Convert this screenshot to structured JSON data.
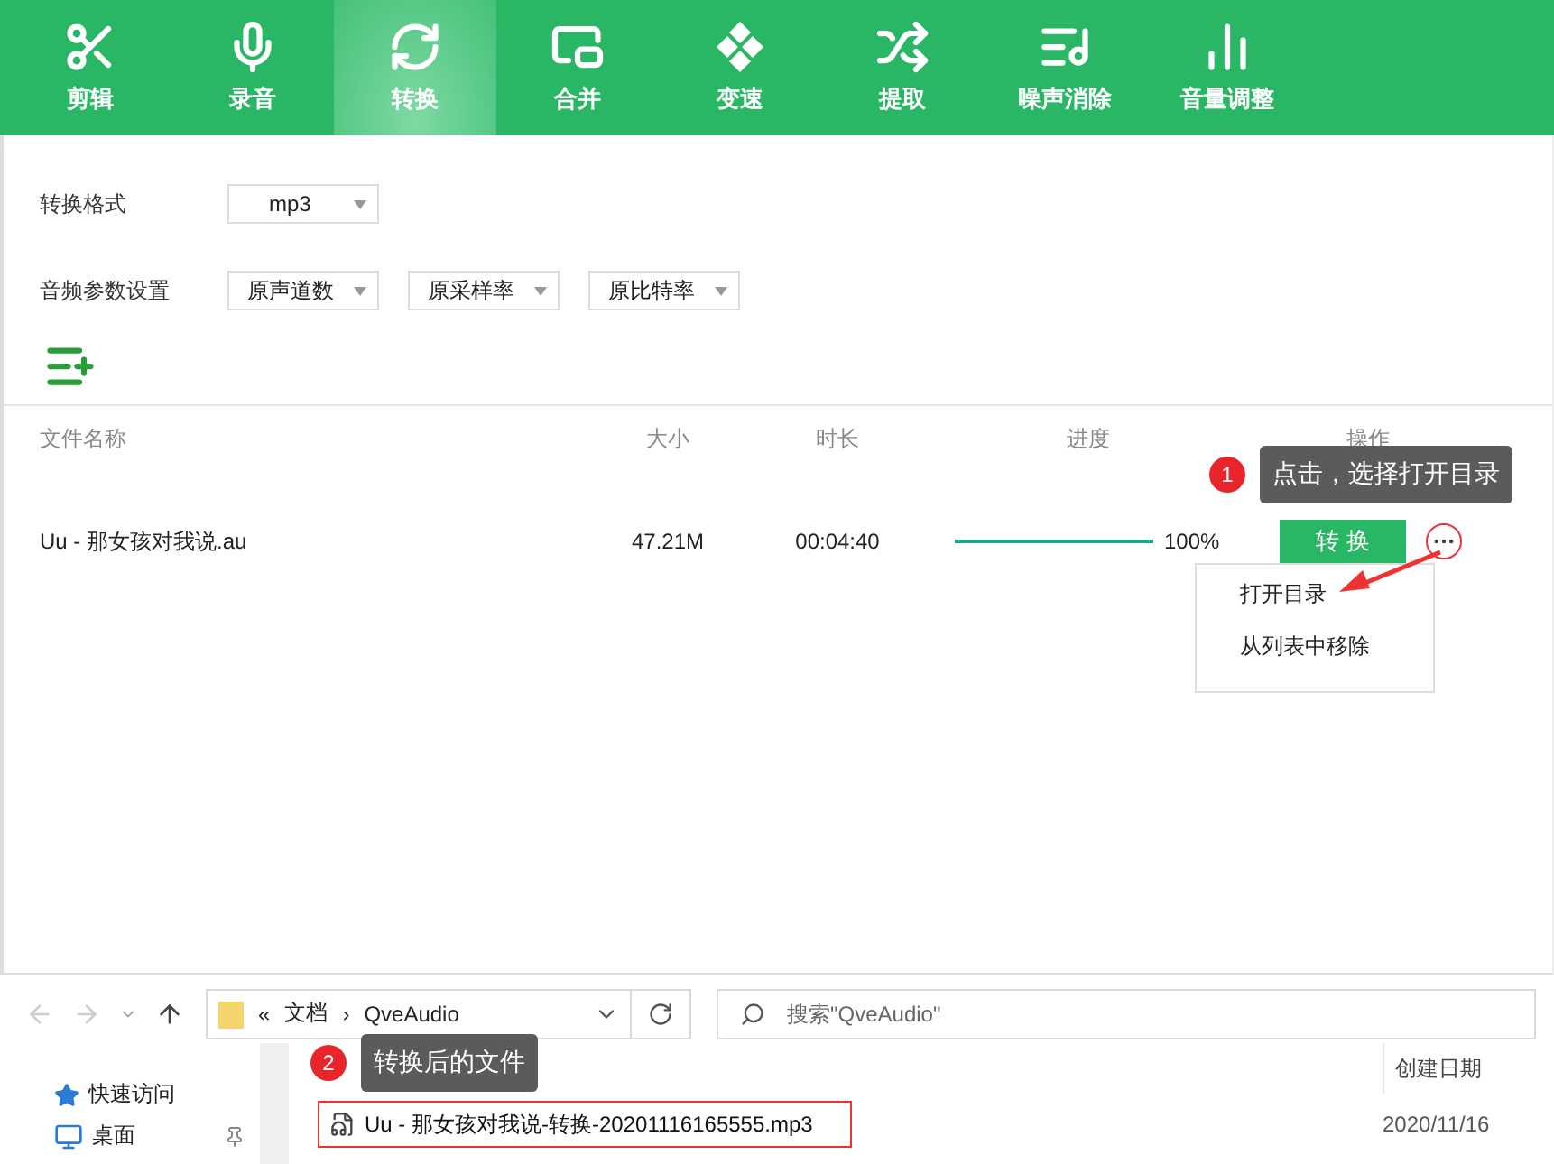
{
  "tabs": [
    {
      "label": "剪辑",
      "selected": false
    },
    {
      "label": "录音",
      "selected": false
    },
    {
      "label": "转换",
      "selected": true
    },
    {
      "label": "合并",
      "selected": false
    },
    {
      "label": "变速",
      "selected": false
    },
    {
      "label": "提取",
      "selected": false
    },
    {
      "label": "噪声消除",
      "selected": false
    },
    {
      "label": "音量调整",
      "selected": false
    }
  ],
  "format": {
    "label": "转换格式",
    "value": "mp3"
  },
  "params": {
    "label": "音频参数设置",
    "selects": [
      "原声道数",
      "原采样率",
      "原比特率"
    ]
  },
  "table": {
    "columns": [
      "文件名称",
      "大小",
      "时长",
      "进度",
      "操作"
    ],
    "rows": [
      {
        "name": "Uu - 那女孩对我说.au",
        "size": "47.21M",
        "duration": "00:04:40",
        "level": 1,
        "progress": "100%",
        "action": "转 换"
      }
    ]
  },
  "menu": {
    "items": [
      "打开目录",
      "从列表中移除"
    ]
  },
  "callouts": [
    {
      "number": "1",
      "text": "点击，选择打开目录"
    },
    {
      "number": "2",
      "text": "转换后的文件"
    }
  ],
  "explorer": {
    "path_prefix": "«",
    "separator": "›",
    "path": [
      "文档",
      "QveAudio"
    ],
    "search": {
      "placeholder": "搜索\"QveAudio\""
    },
    "sidebar": [
      {
        "label": "快速访问"
      },
      {
        "label": "桌面"
      }
    ],
    "columns": [
      "创建日期"
    ],
    "files": [
      {
        "name": "Uu - 那女孩对我说-转换-20201116165555.mp3",
        "date": "2020/11/16"
      }
    ]
  }
}
